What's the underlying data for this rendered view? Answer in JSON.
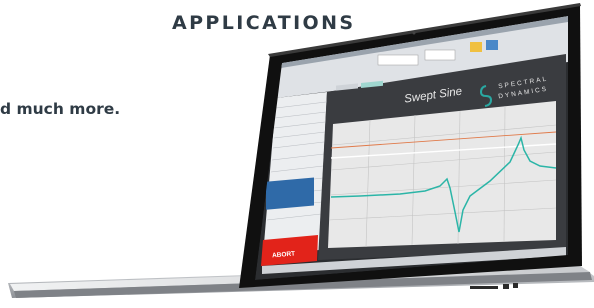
{
  "page": {
    "heading": "APPLICATIONS",
    "tagline_fragment": "d much more."
  },
  "screen": {
    "logo_line1": "SPECTRAL",
    "logo_line2": "DYNAMICS",
    "plot_title": "Swept Sine",
    "abort_label": "ABORT",
    "colors": {
      "abort": "#e2231a",
      "logo_teal": "#29a8a2",
      "trace": "#2bb5a7",
      "plot_bg": "#e8e8e8",
      "frame": "#151515"
    }
  },
  "chart_data": {
    "type": "line",
    "title": "Swept Sine",
    "grid": true,
    "series": [
      {
        "values_description_x": [
          0,
          0.1,
          0.2,
          0.3,
          0.4,
          0.45,
          0.5,
          0.55,
          0.6,
          0.7,
          0.8,
          0.85,
          0.88,
          0.9,
          0.93,
          0.96,
          0.98,
          1.0
        ],
        "y": [
          0.47,
          0.47,
          0.47,
          0.45,
          0.4,
          0.3,
          0.45,
          0.55,
          0.6,
          0.65,
          0.75,
          0.82,
          0.9,
          0.95,
          0.97,
          0.9,
          0.85,
          0.82
        ]
      }
    ]
  }
}
